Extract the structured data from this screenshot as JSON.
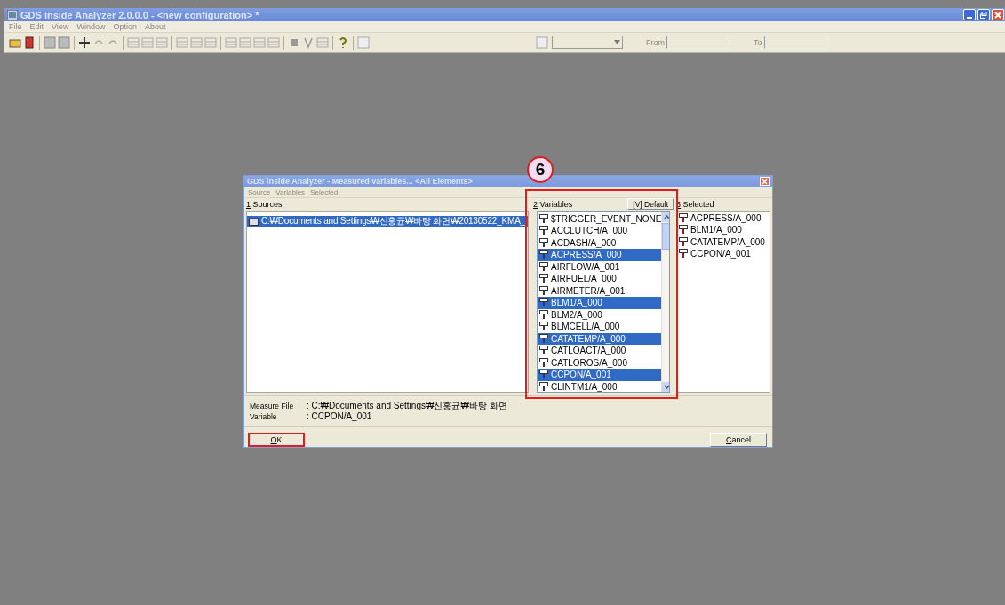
{
  "window": {
    "title": "GDS inside Analyzer 2.0.0.0 - <new configuration> *"
  },
  "menu": [
    {
      "label": "File",
      "disabled": true
    },
    {
      "label": "Edit",
      "disabled": true
    },
    {
      "label": "View",
      "disabled": true
    },
    {
      "label": "Window",
      "disabled": true
    },
    {
      "label": "Option",
      "disabled": true
    },
    {
      "label": "About",
      "disabled": true
    }
  ],
  "toolbar": {
    "from_label": "From",
    "to_label": "To"
  },
  "dialog": {
    "title": "GDS inside Analyzer - Measured variables... <All Elements>",
    "menu": [
      {
        "label": "Source",
        "disabled": true
      },
      {
        "label": "Variables",
        "disabled": true
      },
      {
        "label": "Selected",
        "disabled": true
      }
    ],
    "sources": {
      "label": "1 Sources",
      "items": [
        {
          "text": "C:₩Documents and Settings₩신홍균₩바탕 화면₩20130522_KMA_",
          "selected": true
        }
      ]
    },
    "variables": {
      "label": "2 Variables",
      "default_button": "[V] Default",
      "items": [
        {
          "text": "$TRIGGER_EVENT_NONE",
          "selected": false
        },
        {
          "text": "ACCLUTCH/A_000",
          "selected": false
        },
        {
          "text": "ACDASH/A_000",
          "selected": false
        },
        {
          "text": "ACPRESS/A_000",
          "selected": true
        },
        {
          "text": "AIRFLOW/A_001",
          "selected": false
        },
        {
          "text": "AIRFUEL/A_000",
          "selected": false
        },
        {
          "text": "AIRMETER/A_001",
          "selected": false
        },
        {
          "text": "BLM1/A_000",
          "selected": true
        },
        {
          "text": "BLM2/A_000",
          "selected": false
        },
        {
          "text": "BLMCELL/A_000",
          "selected": false
        },
        {
          "text": "CATATEMP/A_000",
          "selected": true
        },
        {
          "text": "CATLOACT/A_000",
          "selected": false
        },
        {
          "text": "CATLOROS/A_000",
          "selected": false
        },
        {
          "text": "CCPON/A_001",
          "selected": true
        },
        {
          "text": "CLINTM1/A_000",
          "selected": false
        }
      ]
    },
    "selected": {
      "label": "3 Selected",
      "items": [
        "ACPRESS/A_000",
        "BLM1/A_000",
        "CATATEMP/A_000",
        "CCPON/A_001"
      ]
    },
    "info": [
      {
        "label": "Measure File",
        "value": ": C:₩Documents and Settings₩신홍균₩바탕 화면"
      },
      {
        "label": "Variable",
        "value": ": CCPON/A_001"
      }
    ],
    "buttons": [
      {
        "label": "OK",
        "highlighted": true
      },
      {
        "label": "Cancel",
        "highlighted": false
      }
    ]
  },
  "callout": {
    "label": "6"
  }
}
